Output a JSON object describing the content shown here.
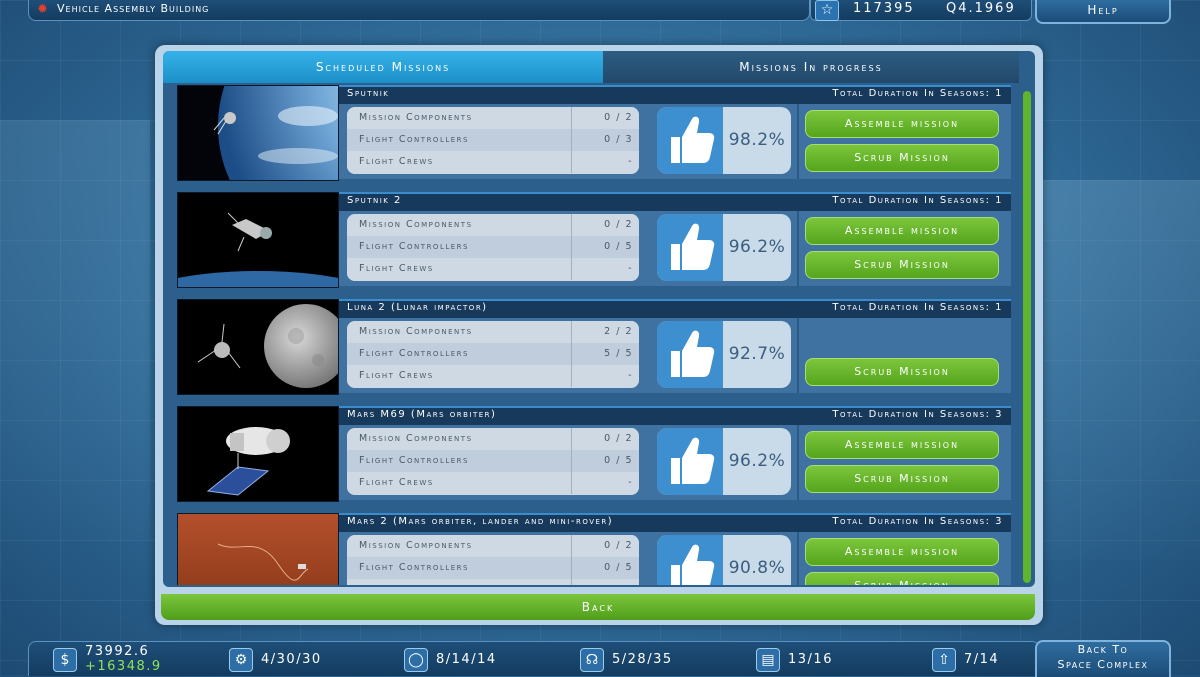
{
  "topbar": {
    "location_title": "Vehicle Assembly Building",
    "score": "117395",
    "date": "Q4.1969",
    "help_label": "Help"
  },
  "tabs": [
    {
      "label": "Scheduled Missions",
      "active": true
    },
    {
      "label": "Missions In progress",
      "active": false
    }
  ],
  "stat_labels": [
    "Mission Components",
    "Flight Controllers",
    "Flight Crews"
  ],
  "missions": [
    {
      "name": "Sputnik",
      "duration": "Total Duration In Seasons: 1",
      "components": "0 / 2",
      "controllers": "0 / 3",
      "crews": "-",
      "rating": "98.2%",
      "assemble_label": "Assemble mission",
      "scrub_label": "Scrub Mission"
    },
    {
      "name": "Sputnik 2",
      "duration": "Total Duration In Seasons: 1",
      "components": "0 / 2",
      "controllers": "0 / 5",
      "crews": "-",
      "rating": "96.2%",
      "assemble_label": "Assemble mission",
      "scrub_label": "Scrub Mission"
    },
    {
      "name": "Luna 2 (Lunar impactor)",
      "duration": "Total Duration In Seasons: 1",
      "components": "2 / 2",
      "controllers": "5 / 5",
      "crews": "-",
      "rating": "92.7%",
      "scrub_label": "Scrub Mission"
    },
    {
      "name": "Mars M69 (Mars orbiter)",
      "duration": "Total Duration In Seasons: 3",
      "components": "0 / 2",
      "controllers": "0 / 5",
      "crews": "-",
      "rating": "96.2%",
      "assemble_label": "Assemble mission",
      "scrub_label": "Scrub Mission"
    },
    {
      "name": "Mars 2 (Mars orbiter, lander and mini-rover)",
      "duration": "Total Duration In Seasons: 3",
      "components": "0 / 2",
      "controllers": "0 / 5",
      "crews": "-",
      "rating": "90.8%",
      "assemble_label": "Assemble mission",
      "scrub_label": "Scrub Mission"
    }
  ],
  "back_label": "Back",
  "bottombar": {
    "funds": "73992.6",
    "income": "+16348.9",
    "engineers": "4/30/30",
    "scientists": "8/14/14",
    "controllers": "5/28/35",
    "facilities": "13/16",
    "launches": "7/14"
  },
  "back_to_complex": [
    "Back To",
    "Space Complex"
  ],
  "icons": {
    "location": "red-gear-icon",
    "score": "star-icon",
    "funds": "dollar-icon",
    "engineers": "gear-icon",
    "scientists": "helmet-icon",
    "controllers": "headset-icon",
    "facilities": "building-icon",
    "launches": "rocket-icon",
    "rating": "thumbs-up-icon"
  },
  "colors": {
    "accent_green": "#6dbb2e",
    "tab_active": "#1c8fc9",
    "rating_text": "#3b5d80"
  }
}
